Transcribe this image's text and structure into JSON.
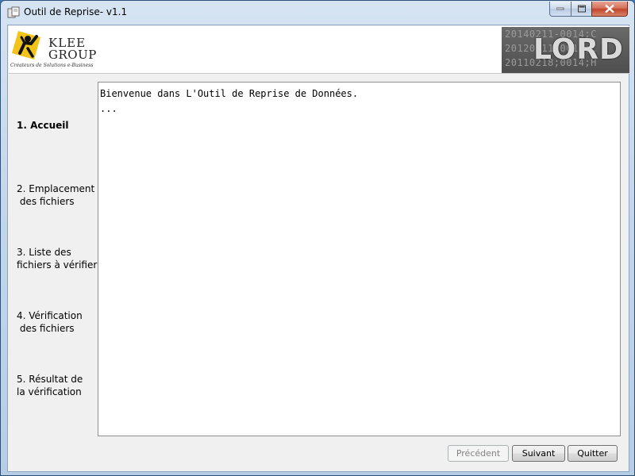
{
  "window": {
    "title": "Outil de Reprise- v1.1"
  },
  "header": {
    "logo": {
      "line1": "KLEE",
      "line2": "GROUP",
      "tagline": "Créateurs de Solutions e-Business"
    },
    "banner": {
      "text": "LORD",
      "code_lines": [
        "20140211-0014;C",
        "20120211-0014;C",
        "20110218;0014;H"
      ]
    }
  },
  "sidebar": {
    "steps": [
      {
        "label": "1. Accueil",
        "active": true
      },
      {
        "label": "2. Emplacement\n des fichiers",
        "active": false
      },
      {
        "label": "3. Liste des\nfichiers à vérifier",
        "active": false
      },
      {
        "label": "4. Vérification\n des fichiers",
        "active": false
      },
      {
        "label": "5. Résultat de\nla vérification",
        "active": false
      }
    ]
  },
  "main": {
    "lines": [
      "Bienvenue dans L'Outil de Reprise de Données.",
      "..."
    ]
  },
  "buttons": {
    "previous": "Précédent",
    "next": "Suivant",
    "quit": "Quitter"
  },
  "colors": {
    "title_bar": "#c4d7ec",
    "client_bg": "#f0f0f0",
    "close_button": "#c2452a"
  }
}
